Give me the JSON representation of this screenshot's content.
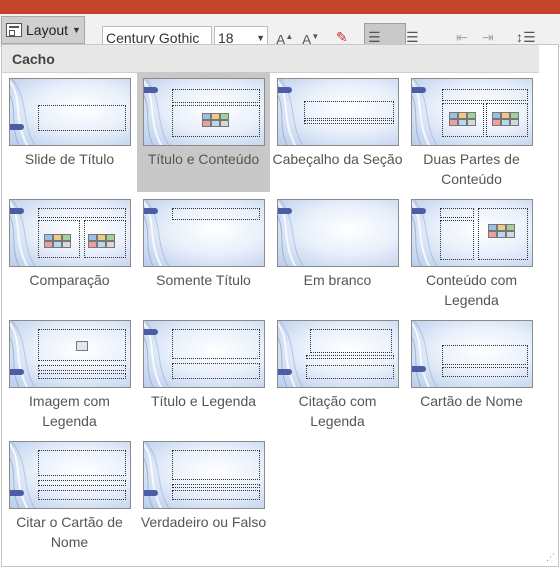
{
  "ribbon": {
    "layout_label": "Layout",
    "font_name": "Century Gothic",
    "font_size": "18",
    "grow_font_glyph": "A",
    "shrink_font_glyph": "A"
  },
  "gallery": {
    "section_title": "Cacho",
    "selected_index": 1,
    "layouts": [
      {
        "label": "Slide de Título"
      },
      {
        "label": "Título e Conteúdo"
      },
      {
        "label": "Cabeçalho da Seção"
      },
      {
        "label": "Duas Partes de Conteúdo"
      },
      {
        "label": "Comparação"
      },
      {
        "label": "Somente Título"
      },
      {
        "label": "Em branco"
      },
      {
        "label": "Conteúdo com Legenda"
      },
      {
        "label": "Imagem com Legenda"
      },
      {
        "label": "Título e Legenda"
      },
      {
        "label": "Citação com Legenda"
      },
      {
        "label": "Cartão de Nome"
      },
      {
        "label": "Citar o Cartão de Nome"
      },
      {
        "label": "Verdadeiro ou Falso"
      }
    ]
  },
  "colors": {
    "accent_orange": "#c5432a",
    "selection_gray": "#c8c8c8",
    "slide_tab_blue": "#4a5da5"
  }
}
